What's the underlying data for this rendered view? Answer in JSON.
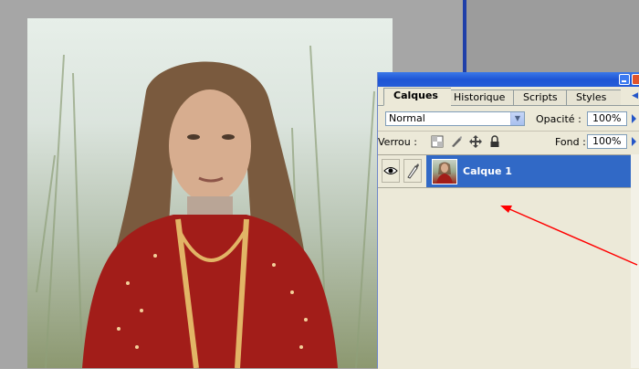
{
  "palette": {
    "tabs": [
      {
        "label": "Calques"
      },
      {
        "label": "Historique"
      },
      {
        "label": "Scripts"
      },
      {
        "label": "Styles"
      }
    ],
    "blend_mode": "Normal",
    "opacity_label": "Opacité :",
    "opacity_value": "100%",
    "lock_label": "Verrou :",
    "fill_label": "Fond :",
    "fill_value": "100%",
    "layers": [
      {
        "name": "Calque 1",
        "visible": true,
        "selected": true
      }
    ]
  },
  "colors": {
    "selection": "#3169c6",
    "titlebar": "#245cd8",
    "annotation_arrow": "#ff0000"
  },
  "icons": [
    "eye-icon",
    "brush-icon",
    "lock-transparency-icon",
    "lock-paint-icon",
    "lock-move-icon",
    "lock-all-icon",
    "minimize-icon",
    "close-icon"
  ]
}
